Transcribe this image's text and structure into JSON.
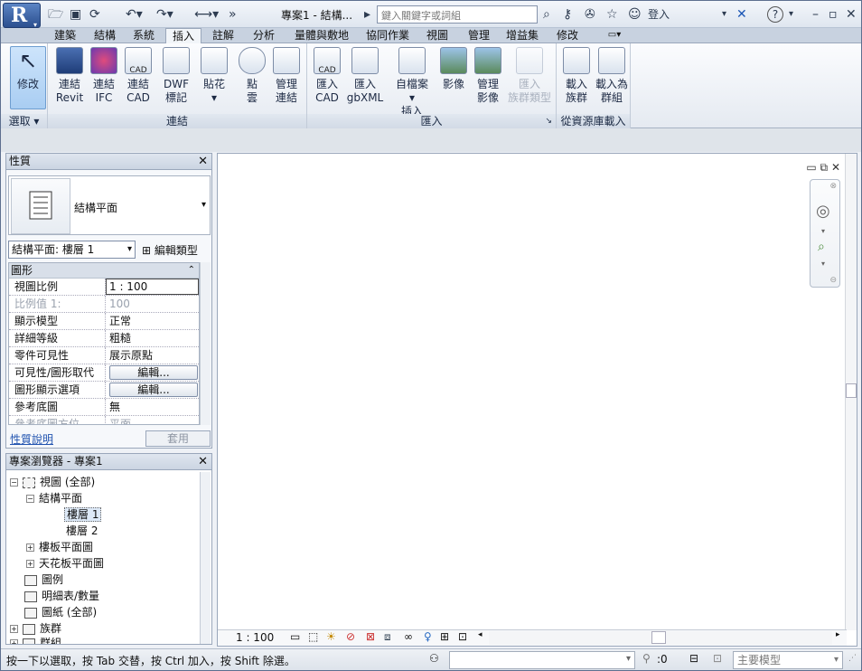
{
  "title_bar": {
    "document_title": "專案1 - 結構...",
    "search_placeholder": "鍵入關鍵字或詞組",
    "signin_label": "登入",
    "help_label": "?"
  },
  "tabs": [
    "建築",
    "結構",
    "系統",
    "插入",
    "註解",
    "分析",
    "量體與敷地",
    "協同作業",
    "視圖",
    "管理",
    "增益集",
    "修改"
  ],
  "active_tab": "插入",
  "ribbon": {
    "select_panel": {
      "label": "選取",
      "button": "修改"
    },
    "link_panel": {
      "label": "連結",
      "buttons": [
        {
          "line1": "連結",
          "line2": "Revit"
        },
        {
          "line1": "連結",
          "line2": "IFC"
        },
        {
          "line1": "連結",
          "line2": "CAD"
        },
        {
          "line1": "DWF",
          "line2": "標記"
        },
        {
          "line1": "貼花",
          "line2": ""
        },
        {
          "line1": "點",
          "line2": "雲"
        },
        {
          "line1": "管理",
          "line2": "連結"
        }
      ]
    },
    "import_panel": {
      "label": "匯入",
      "buttons": [
        {
          "line1": "匯入",
          "line2": "CAD"
        },
        {
          "line1": "匯入",
          "line2": "gbXML"
        },
        {
          "line1": "自檔案",
          "line2": "插入"
        },
        {
          "line1": "影像",
          "line2": ""
        },
        {
          "line1": "管理",
          "line2": "影像"
        },
        {
          "line1": "匯入",
          "line2": "族群類型"
        }
      ]
    },
    "load_panel": {
      "label": "從資源庫載入",
      "buttons": [
        {
          "line1": "載入",
          "line2": "族群"
        },
        {
          "line1": "載入為",
          "line2": "群組"
        }
      ]
    }
  },
  "properties": {
    "title": "性質",
    "type_name": "結構平面",
    "instance_selector": "結構平面: 樓層 1",
    "edit_type_label": "編輯類型",
    "group_label": "圖形",
    "rows": [
      {
        "name": "視圖比例",
        "value": "1 : 100"
      },
      {
        "name": "比例值 1:",
        "value": "100"
      },
      {
        "name": "顯示模型",
        "value": "正常"
      },
      {
        "name": "詳細等級",
        "value": "粗糙"
      },
      {
        "name": "零件可見性",
        "value": "展示原點"
      },
      {
        "name": "可見性/圖形取代",
        "value": "編輯..."
      },
      {
        "name": "圖形顯示選項",
        "value": "編輯..."
      },
      {
        "name": "參考底圖",
        "value": "無"
      },
      {
        "name": "參考底圖方位",
        "value": "平面"
      }
    ],
    "help_link": "性質說明",
    "apply_label": "套用"
  },
  "browser": {
    "title": "專案瀏覽器 - 專案1",
    "nodes": [
      {
        "label": "視圖 (全部)"
      },
      {
        "label": "結構平面"
      },
      {
        "label": "樓層 1"
      },
      {
        "label": "樓層 2"
      },
      {
        "label": "樓板平面圖"
      },
      {
        "label": "天花板平面圖"
      },
      {
        "label": "圖例"
      },
      {
        "label": "明細表/數量"
      },
      {
        "label": "圖紙 (全部)"
      },
      {
        "label": "族群"
      },
      {
        "label": "群組"
      }
    ]
  },
  "view_control": {
    "scale": "1 : 100"
  },
  "status": {
    "text": "按一下以選取，按 Tab 交替，按 Ctrl 加入，按 Shift 除選。",
    "filter_count": ":0",
    "model_combo": "主要模型"
  }
}
